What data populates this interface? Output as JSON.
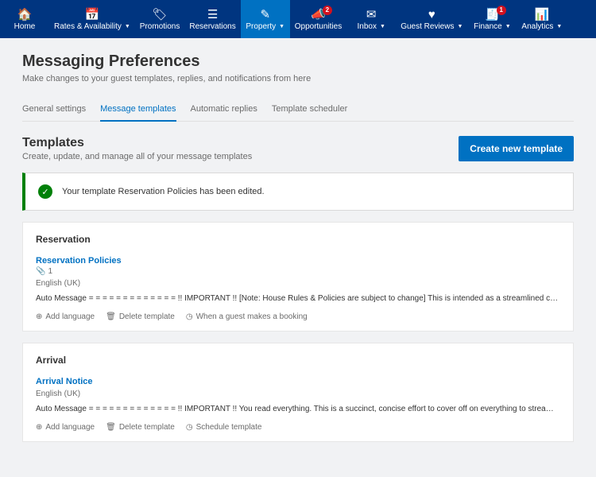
{
  "nav": [
    {
      "label": "Home",
      "icon": "🏠",
      "dropdown": false,
      "badge": null,
      "active": false
    },
    {
      "label": "Rates & Availability",
      "icon": "📅",
      "dropdown": true,
      "badge": null,
      "active": false
    },
    {
      "label": "Promotions",
      "icon": "🏷",
      "dropdown": false,
      "badge": null,
      "active": false
    },
    {
      "label": "Reservations",
      "icon": "☰",
      "dropdown": false,
      "badge": null,
      "active": false
    },
    {
      "label": "Property",
      "icon": "✎",
      "dropdown": true,
      "badge": null,
      "active": true
    },
    {
      "label": "Opportunities",
      "icon": "📣",
      "dropdown": false,
      "badge": "2",
      "active": false
    },
    {
      "label": "Inbox",
      "icon": "✉",
      "dropdown": true,
      "badge": null,
      "active": false
    },
    {
      "label": "Guest Reviews",
      "icon": "♥",
      "dropdown": true,
      "badge": null,
      "active": false
    },
    {
      "label": "Finance",
      "icon": "🧾",
      "dropdown": true,
      "badge": "1",
      "active": false
    },
    {
      "label": "Analytics",
      "icon": "📊",
      "dropdown": true,
      "badge": null,
      "active": false
    }
  ],
  "page": {
    "title": "Messaging Preferences",
    "subtitle": "Make changes to your guest templates, replies, and notifications from here"
  },
  "tabs": [
    {
      "label": "General settings",
      "active": false
    },
    {
      "label": "Message templates",
      "active": true
    },
    {
      "label": "Automatic replies",
      "active": false
    },
    {
      "label": "Template scheduler",
      "active": false
    }
  ],
  "templates_section": {
    "heading": "Templates",
    "desc": "Create, update, and manage all of your message templates",
    "create_button": "Create new template"
  },
  "alert": {
    "text": "Your template Reservation Policies has been edited."
  },
  "groups": [
    {
      "heading": "Reservation",
      "template": {
        "title": "Reservation Policies",
        "attachments": "1",
        "language": "English (UK)",
        "body": "Auto Message = = = = = = = = = = = = = !! IMPORTANT !! [Note: House Rules & Policies are subject to change] This is intended as a streamlined concise collection of related inf…"
      },
      "actions": {
        "add_language": "Add language",
        "delete": "Delete template",
        "schedule": "When a guest makes a booking"
      }
    },
    {
      "heading": "Arrival",
      "template": {
        "title": "Arrival Notice",
        "attachments": null,
        "language": "English (UK)",
        "body": "Auto Message = = = = = = = = = = = = = !! IMPORTANT !! You read everything. This is a succinct, concise effort to cover off on everything to streamline your stay. ~~~~~~~~~~ …"
      },
      "actions": {
        "add_language": "Add language",
        "delete": "Delete template",
        "schedule": "Schedule template"
      }
    }
  ]
}
